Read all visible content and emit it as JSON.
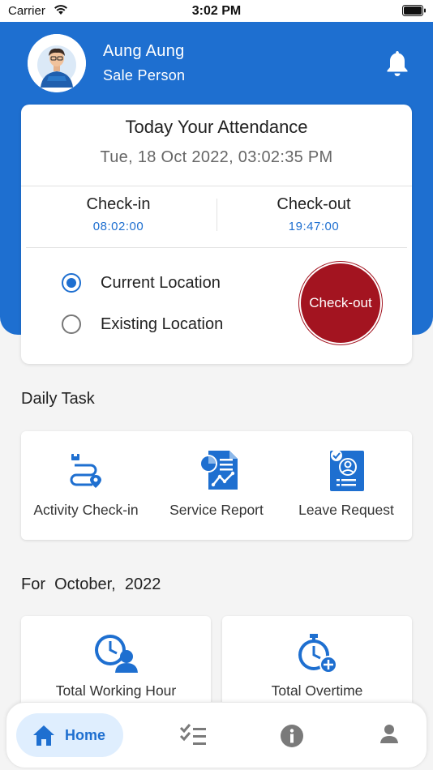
{
  "status_bar": {
    "carrier": "Carrier",
    "time": "3:02 PM"
  },
  "user": {
    "name": "Aung Aung",
    "role": "Sale Person"
  },
  "attendance": {
    "title": "Today Your Attendance",
    "datetime": "Tue, 18 Oct 2022, 03:02:35 PM",
    "check_in_label": "Check-in",
    "check_in_time": "08:02:00",
    "check_out_label": "Check-out",
    "check_out_time": "19:47:00",
    "location_options": [
      {
        "label": "Current Location",
        "selected": true
      },
      {
        "label": "Existing Location",
        "selected": false
      }
    ],
    "action_button": "Check-out"
  },
  "daily_task": {
    "title": "Daily Task",
    "items": [
      {
        "label": "Activity Check-in",
        "icon": "activity-checkin-icon"
      },
      {
        "label": "Service Report",
        "icon": "service-report-icon"
      },
      {
        "label": "Leave Request",
        "icon": "leave-request-icon"
      }
    ]
  },
  "monthly": {
    "prefix": "For",
    "month": "October,",
    "year": "2022",
    "cards": [
      {
        "label": "Total Working Hour",
        "icon": "working-hour-icon"
      },
      {
        "label": "Total Overtime",
        "icon": "overtime-icon"
      }
    ]
  },
  "nav": {
    "items": [
      {
        "label": "Home",
        "icon": "home-icon",
        "active": true
      },
      {
        "label": "",
        "icon": "tasks-icon",
        "active": false
      },
      {
        "label": "",
        "icon": "info-icon",
        "active": false
      },
      {
        "label": "",
        "icon": "profile-icon",
        "active": false
      }
    ]
  },
  "colors": {
    "primary": "#1e6fd0",
    "checkout": "#a31420",
    "background": "#f4f4f4"
  }
}
